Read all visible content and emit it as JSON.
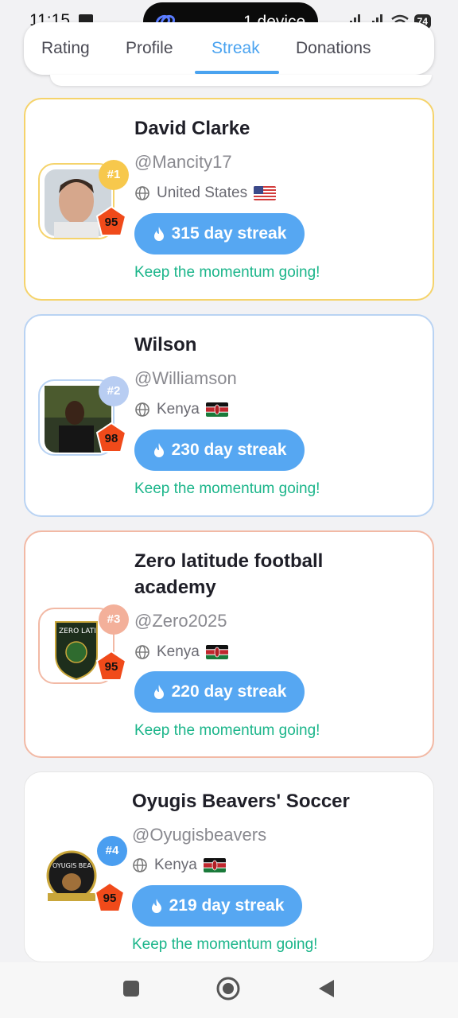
{
  "status": {
    "time": "11:15",
    "device_pill": "1 device",
    "battery": "74"
  },
  "tabs": [
    {
      "label": "Rating"
    },
    {
      "label": "Profile"
    },
    {
      "label": "Streak",
      "active": true
    },
    {
      "label": "Donations"
    }
  ],
  "players": [
    {
      "rank": "#1",
      "rating": "95",
      "name": "David Clarke",
      "handle": "@Mancity17",
      "country": "United States",
      "flag_icon": "us-flag-icon",
      "streak": "315 day streak",
      "message": "Keep the momentum going!",
      "accent": "#f5d36b",
      "rank_color": "#f7c84c"
    },
    {
      "rank": "#2",
      "rating": "98",
      "name": "Wilson",
      "handle": "@Williamson",
      "country": "Kenya",
      "flag_icon": "kenya-flag-icon",
      "streak": "230 day streak",
      "message": "Keep the momentum going!",
      "accent": "#b9d3f3",
      "rank_color": "#b8cdf2"
    },
    {
      "rank": "#3",
      "rating": "95",
      "name": "Zero latitude football academy",
      "handle": "@Zero2025",
      "country": "Kenya",
      "flag_icon": "kenya-flag-icon",
      "streak": "220 day streak",
      "message": "Keep the momentum going!",
      "accent": "#f2b9a5",
      "rank_color": "#f3b09a"
    },
    {
      "rank": "#4",
      "rating": "95",
      "name": "Oyugis Beavers' Soccer",
      "handle": "@Oyugisbeavers",
      "country": "Kenya",
      "flag_icon": "kenya-flag-icon",
      "streak": "219 day streak",
      "message": "Keep the momentum going!",
      "accent": "#ffffff",
      "rank_color": "#4a9ef0"
    }
  ],
  "navbar": {
    "recents": "square-icon",
    "home": "circle-icon",
    "back": "triangle-back-icon"
  },
  "colors": {
    "accent": "#4aa3f0",
    "streak_bg": "#56a7f2",
    "message": "#1bb58a",
    "rating_badge": "#f04a1a"
  }
}
